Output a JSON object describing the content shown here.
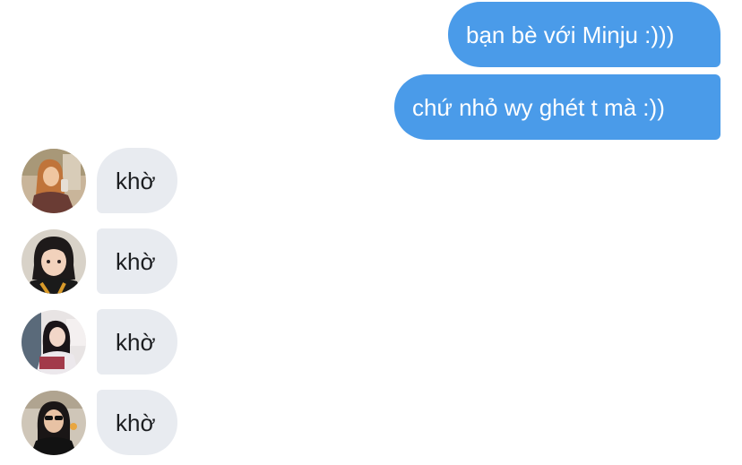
{
  "conversation": {
    "sent": [
      {
        "text": "bạn bè với Minju :)))"
      },
      {
        "text": "chứ nhỏ wy ghét t mà :))"
      }
    ],
    "received": [
      {
        "text": "khờ",
        "avatar": "user-photo-avatar"
      },
      {
        "text": "khờ",
        "avatar": "user-photo-avatar"
      },
      {
        "text": "khờ",
        "avatar": "user-photo-avatar"
      },
      {
        "text": "khờ",
        "avatar": "user-photo-avatar"
      }
    ]
  },
  "colors": {
    "sent_bubble": "#4a9be9",
    "received_bubble": "#e8ebf0",
    "sent_text": "#ffffff",
    "received_text": "#1c1e21"
  }
}
